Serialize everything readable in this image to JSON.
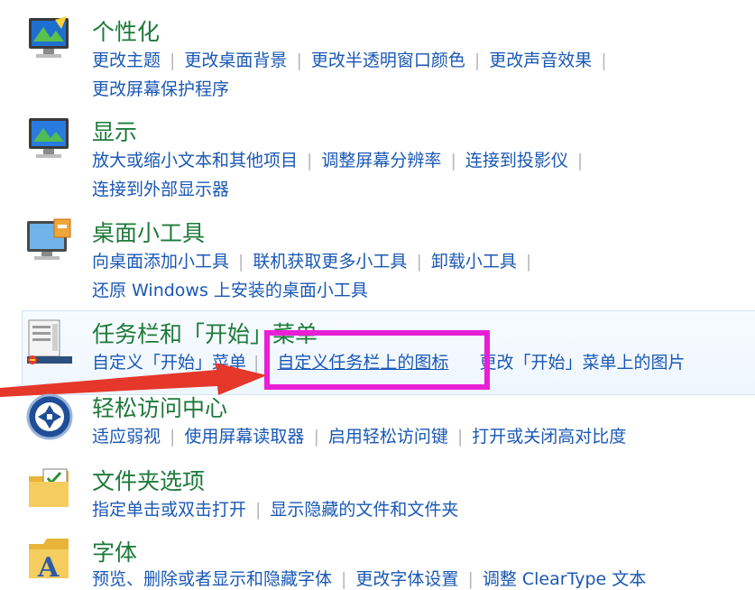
{
  "sections": [
    {
      "title": "个性化",
      "line1": [
        "更改主题",
        "更改桌面背景",
        "更改半透明窗口颜色",
        "更改声音效果"
      ],
      "line2": [
        "更改屏幕保护程序"
      ]
    },
    {
      "title": "显示",
      "line1": [
        "放大或缩小文本和其他项目",
        "调整屏幕分辨率",
        "连接到投影仪"
      ],
      "line2": [
        "连接到外部显示器"
      ]
    },
    {
      "title": "桌面小工具",
      "line1": [
        "向桌面添加小工具",
        "联机获取更多小工具",
        "卸载小工具"
      ],
      "line2": [
        "还原 Windows 上安装的桌面小工具"
      ]
    },
    {
      "title": "任务栏和「开始」菜单",
      "line1": [
        "自定义「开始」菜单",
        "自定义任务栏上的图标",
        "更改「开始」菜单上的图片"
      ]
    },
    {
      "title": "轻松访问中心",
      "line1": [
        "适应弱视",
        "使用屏幕读取器",
        "启用轻松访问键",
        "打开或关闭高对比度"
      ]
    },
    {
      "title": "文件夹选项",
      "line1": [
        "指定单击或双击打开",
        "显示隐藏的文件和文件夹"
      ]
    },
    {
      "title": "字体",
      "line1": [
        "预览、删除或者显示和隐藏字体",
        "更改字体设置",
        "调整 ClearType 文本"
      ]
    }
  ],
  "highlight": {
    "color": "#e81fd6",
    "arrow_color": "#e5372a"
  },
  "icons": [
    "personalization-monitor-icon",
    "display-monitor-icon",
    "gadgets-monitor-icon",
    "taskbar-icon",
    "ease-of-access-icon",
    "folder-options-icon",
    "fonts-icon"
  ]
}
